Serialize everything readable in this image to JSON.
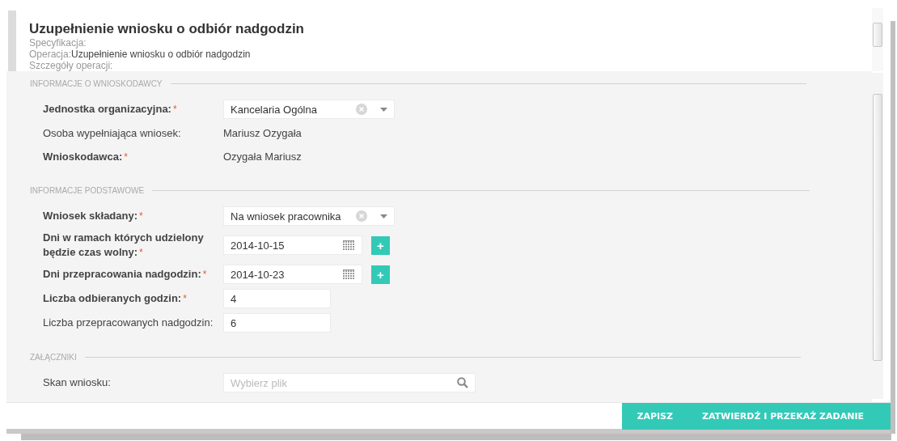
{
  "header": {
    "title": "Uzupełnienie wniosku o odbiór nadgodzin",
    "specification_label": "Specyfikacja:",
    "operation_label": "Operacja:",
    "operation_value": "Uzupełnienie wniosku o odbiór nadgodzin",
    "details_label": "Szczegóły operacji:"
  },
  "sections": [
    {
      "title": "INFORMACJE O WNIOSKODAWCY",
      "fields": [
        {
          "kind": "select",
          "label": "Jednostka organizacyjna:",
          "required_mark": "*",
          "value": "Kancelaria Ogólna"
        },
        {
          "kind": "static",
          "label": "Osoba wypełniająca wniosek:",
          "value": "Mariusz Ozygała"
        },
        {
          "kind": "static",
          "label": "Wnioskodawca:",
          "required_mark": "*",
          "value": "Ozygała Mariusz"
        }
      ]
    },
    {
      "title": "INFORMACJE PODSTAWOWE",
      "fields": [
        {
          "kind": "select",
          "label": "Wniosek składany:",
          "required_mark": "*",
          "value": "Na wniosek pracownika"
        },
        {
          "kind": "date",
          "label": "Dni w ramach których udzielony będzie czas wolny:",
          "required_mark": "*",
          "value": "2014-10-15",
          "add": "+"
        },
        {
          "kind": "date",
          "label": "Dni przepracowania nadgodzin:",
          "required_mark": "*",
          "value": "2014-10-23",
          "add": "+"
        },
        {
          "kind": "text",
          "label": "Liczba odbieranych godzin:",
          "required_mark": "*",
          "value": "4"
        },
        {
          "kind": "text",
          "label": "Liczba przepracowanych nadgodzin:",
          "value": "6"
        }
      ]
    },
    {
      "title": "ZAŁĄCZNIKI",
      "fields": [
        {
          "kind": "file",
          "label": "Skan wniosku:",
          "placeholder": "Wybierz plik"
        }
      ]
    }
  ],
  "buttons": [
    "ZAPISZ",
    "ZATWIERDŹ I PRZEKAŻ ZADANIE"
  ]
}
